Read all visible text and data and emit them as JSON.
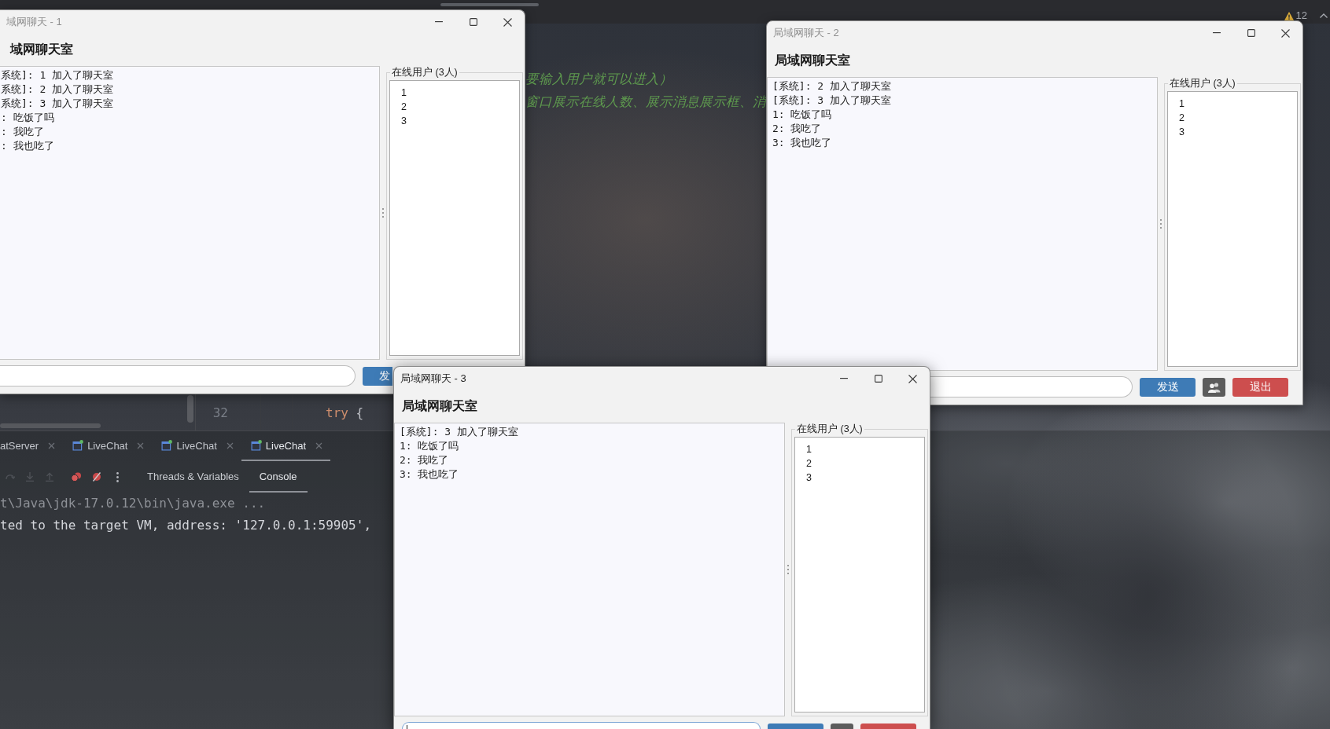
{
  "ide": {
    "warning_count": "12",
    "editor": {
      "comment_lines": [
        "要输入用户就可以进入）",
        "窗口展示在线人数、展示消息展示框、消"
      ],
      "line_number": "32",
      "code": [
        {
          "kind": "keyword",
          "text": "try"
        },
        {
          "kind": "plain",
          "text": " {"
        }
      ]
    },
    "run_tabs": [
      {
        "label": "atServer",
        "icon": false,
        "selected": false
      },
      {
        "label": "LiveChat",
        "icon": true,
        "selected": false
      },
      {
        "label": "LiveChat",
        "icon": true,
        "selected": false
      },
      {
        "label": "LiveChat",
        "icon": true,
        "selected": true
      }
    ],
    "debug_tabs": [
      {
        "label": "Threads & Variables",
        "selected": false
      },
      {
        "label": "Console",
        "selected": true
      }
    ],
    "console_lines": [
      {
        "kind": "command",
        "text": "t\\Java\\jdk-17.0.12\\bin\\java.exe ..."
      },
      {
        "kind": "output",
        "text": "ted to the target VM, address: '127.0.0.1:59905',"
      }
    ]
  },
  "windows": [
    {
      "title": "域网聊天 - 1",
      "active": false,
      "heading": "域网聊天室",
      "messages": [
        "系统]: 1 加入了聊天室",
        "系统]: 2 加入了聊天室",
        "系统]: 3 加入了聊天室",
        ": 吃饭了吗",
        ": 我吃了",
        ": 我也吃了"
      ],
      "users_label": "在线用户 (3人)",
      "users": [
        "1",
        "2",
        "3"
      ],
      "input": {
        "focused": false
      },
      "buttons": [
        {
          "kind": "send",
          "label": "发"
        }
      ]
    },
    {
      "title": "局域网聊天 - 2",
      "active": false,
      "heading": "局域网聊天室",
      "messages": [
        "[系统]: 2 加入了聊天室",
        "[系统]: 3 加入了聊天室",
        "1: 吃饭了吗",
        "2: 我吃了",
        "3: 我也吃了"
      ],
      "users_label": "在线用户 (3人)",
      "users": [
        "1",
        "2",
        "3"
      ],
      "input": {
        "focused": false
      },
      "buttons": [
        {
          "kind": "send",
          "label": "发送"
        },
        {
          "kind": "users"
        },
        {
          "kind": "exit",
          "label": "退出"
        }
      ]
    },
    {
      "title": "局域网聊天 - 3",
      "active": true,
      "heading": "局域网聊天室",
      "messages": [
        "[系统]: 3 加入了聊天室",
        "1: 吃饭了吗",
        "2: 我吃了",
        "3: 我也吃了"
      ],
      "users_label": "在线用户 (3人)",
      "users": [
        "1",
        "2",
        "3"
      ],
      "input": {
        "focused": true
      },
      "buttons": [
        {
          "kind": "send"
        },
        {
          "kind": "users"
        },
        {
          "kind": "exit"
        }
      ]
    }
  ]
}
